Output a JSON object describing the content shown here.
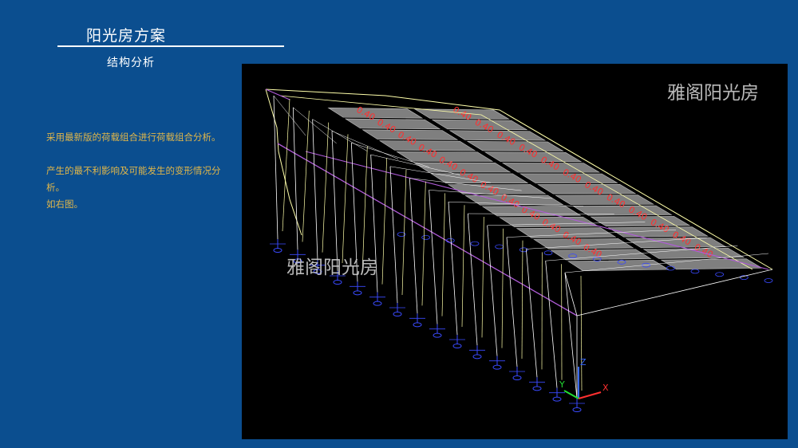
{
  "slide": {
    "title": "阳光房方案",
    "subtitle": "结构分析"
  },
  "description": {
    "line1": "采用最新版的荷载组合进行荷载组合分析。",
    "line2": "产生的最不利影响及可能发生的变形情况分析。",
    "line3": "如右图。"
  },
  "viewport": {
    "watermark_top": "雅阁阳光房",
    "watermark_mid": "雅阁阳光房",
    "panel_label": "0.40",
    "axes": {
      "x": "X",
      "y": "Y",
      "z": "Z"
    },
    "colors": {
      "background": "#000000",
      "frame": "#ffffaa",
      "member": "#ffffff",
      "beam": "#b05cd8",
      "support": "#3a4aff",
      "panel": "#7f7f7f",
      "label": "#ff3030",
      "axis_x": "#ff3030",
      "axis_y": "#22dd33",
      "axis_z": "#3a6bff"
    }
  }
}
